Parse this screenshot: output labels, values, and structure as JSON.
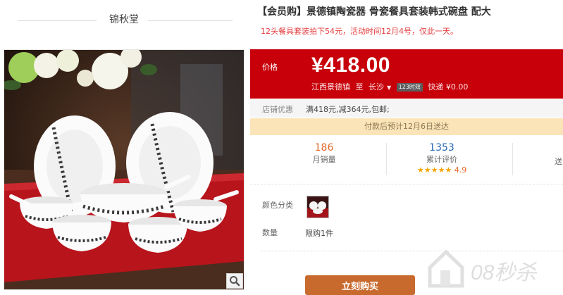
{
  "shop": {
    "name": "锦秋堂"
  },
  "product": {
    "title": "【会员购】景德镇陶瓷器 骨瓷餐具套装韩式碗盘 配大",
    "subtitle": "12头餐具套装拍下54元，活动时间12月4号，仅此一天。"
  },
  "price": {
    "label": "价格",
    "value": "¥418.00",
    "origin": "江西景德镇",
    "to": "至",
    "destination": "长沙",
    "caret": "▼",
    "time_badge": "123时效",
    "shipping": "快递 ¥0.00"
  },
  "promo": {
    "label": "店铺优惠",
    "value": "满418元,减364元,包邮;"
  },
  "delivery": {
    "text": "付款后预计12月6日送达"
  },
  "stats": {
    "monthly_sales": {
      "value": "186",
      "label": "月销量"
    },
    "reviews": {
      "value": "1353",
      "label": "累计评价",
      "stars": "★★★★★",
      "rating": "4.9"
    },
    "more": "送"
  },
  "options": {
    "color_label": "颜色分类",
    "quantity_label": "数量",
    "quantity_value": "限购1件"
  },
  "buy_button": {
    "label": "立刻购买"
  },
  "watermark": {
    "text": "08秒杀"
  },
  "colors": {
    "price_bg": "#c7000a",
    "buy_button": "#c86a2e",
    "promo_text": "#e4393c"
  }
}
